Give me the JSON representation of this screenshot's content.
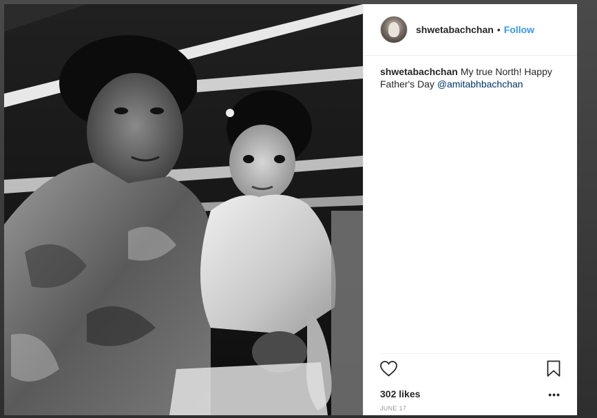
{
  "post": {
    "username": "shwetabachchan",
    "separator": "•",
    "follow_label": "Follow",
    "caption": {
      "username": "shwetabachchan",
      "text_before": "My true North! Happy Father's Day ",
      "mention": "@amitabhbachchan"
    },
    "likes": "302 likes",
    "date": "JUNE 17",
    "more_label": "•••"
  },
  "icons": {
    "like": "heart-outline-icon",
    "save": "bookmark-outline-icon",
    "more": "more-options-icon"
  },
  "colors": {
    "accent": "#3897f0",
    "mention": "#003569",
    "text": "#262626",
    "muted": "#999999",
    "divider": "#efefef"
  }
}
